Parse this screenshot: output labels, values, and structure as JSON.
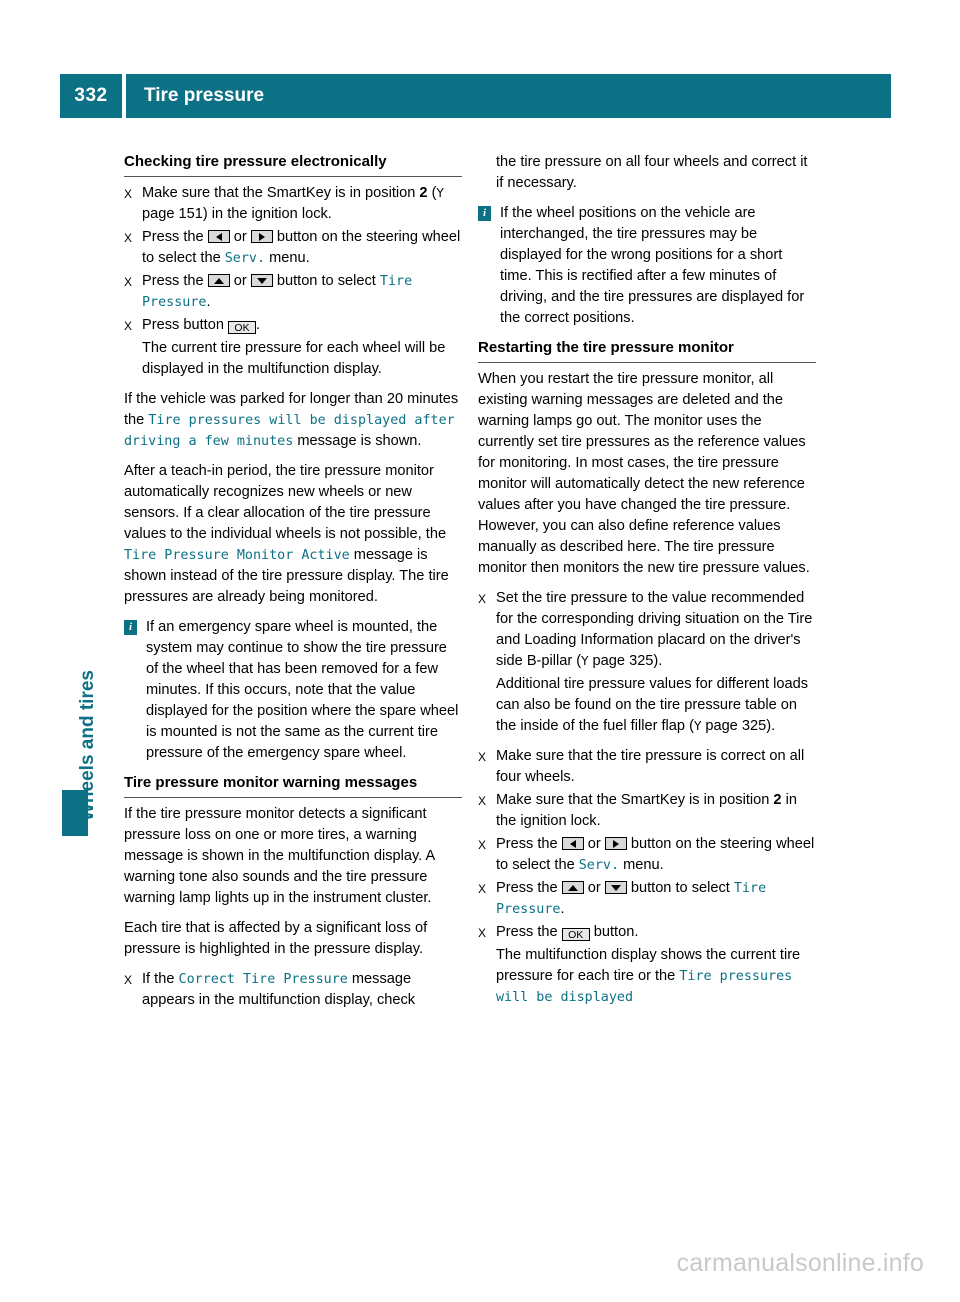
{
  "header": {
    "page_number": "332",
    "title": "Tire pressure",
    "accent_color": "#0d7186"
  },
  "side_tab": {
    "label": "Wheels and tires"
  },
  "watermark": "carmanualsonline.info",
  "left_column": {
    "section1_title": "Checking tire pressure electronically",
    "steps": [
      {
        "a": "Make sure that the SmartKey is in position ",
        "b": "2",
        "c": " (",
        "d": "Y",
        "e": " page 151) in the ignition lock."
      },
      {
        "a": "Press the ",
        "b": " or ",
        "c": " button on the steering wheel to select the ",
        "d": "Serv.",
        "e": " menu."
      },
      {
        "a": "Press the ",
        "b": " or ",
        "c": " button to select ",
        "d": "Tire Pressure",
        "e": "."
      },
      {
        "a": "Press button ",
        "b": "OK",
        "c": "."
      }
    ],
    "step4_sub": "The current tire pressure for each wheel will be displayed in the multifunction display.",
    "para_parked_1": "If the vehicle was parked for longer than 20 minutes the ",
    "para_parked_mono": "Tire pressures will be displayed after driving a few minutes",
    "para_parked_2": " message is shown.",
    "para_teachin_1": "After a teach-in period, the tire pressure monitor automatically recognizes new wheels or new sensors. If a clear allocation of the tire pressure values to the individual wheels is not possible, the ",
    "para_teachin_mono": "Tire Pressure Monitor Active",
    "para_teachin_2": " message is shown instead of the tire pressure display. The tire pressures are already being monitored.",
    "note_spare": "If an emergency spare wheel is mounted, the system may continue to show the tire pressure of the wheel that has been removed for a few minutes. If this occurs, note that the value displayed for the position where the spare wheel is mounted is not the same as the current tire pressure of the emergency spare wheel.",
    "section2_title": "Tire pressure monitor warning messages",
    "para_warn_1": "If the tire pressure monitor detects a significant pressure loss on one or more tires, a warning message is shown in the multifunction display. A warning tone also sounds and the tire pressure warning lamp lights up in the instrument cluster.",
    "para_warn_2": "Each tire that is affected by a significant loss of pressure is highlighted in the pressure display.",
    "step_correct": {
      "a": "If the ",
      "mono": "Correct Tire Pressure",
      "b": " message appears in the multifunction display, check"
    }
  },
  "right_column": {
    "continuation": "the tire pressure on all four wheels and correct it if necessary.",
    "note_interchanged": "If the wheel positions on the vehicle are interchanged, the tire pressures may be displayed for the wrong positions for a short time. This is rectified after a few minutes of driving, and the tire pressures are displayed for the correct positions.",
    "section_title": "Restarting the tire pressure monitor",
    "para_restart": "When you restart the tire pressure monitor, all existing warning messages are deleted and the warning lamps go out. The monitor uses the currently set tire pressures as the reference values for monitoring. In most cases, the tire pressure monitor will automatically detect the new reference values after you have changed the tire pressure. However, you can also define reference values manually as described here. The tire pressure monitor then monitors the new tire pressure values.",
    "step_set": {
      "a": "Set the tire pressure to the value recommended for the corresponding driving situation on the Tire and Loading Information placard on the driver's side B-pillar (",
      "y": "Y",
      "b": " page 325)."
    },
    "step_set_sub": {
      "a": "Additional tire pressure values for different loads can also be found on the tire pressure table on the inside of the fuel filler flap (",
      "y": "Y",
      "b": " page 325)."
    },
    "step_four_wheels": "Make sure that the tire pressure is correct on all four wheels.",
    "step_smartkey": {
      "a": "Make sure that the SmartKey is in position ",
      "b": "2",
      "c": " in the ignition lock."
    },
    "step_press_lr": {
      "a": "Press the ",
      "b": " or ",
      "c": " button on the steering wheel to select the ",
      "d": "Serv.",
      "e": " menu."
    },
    "step_press_ud": {
      "a": "Press the ",
      "b": " or ",
      "c": " button to select ",
      "d": "Tire Pressure",
      "e": "."
    },
    "step_press_ok": {
      "a": "Press the ",
      "b": "OK",
      "c": " button."
    },
    "step_ok_sub_1": "The multifunction display shows the current tire pressure for each tire or the ",
    "step_ok_sub_mono": "Tire pressures will be displayed"
  }
}
